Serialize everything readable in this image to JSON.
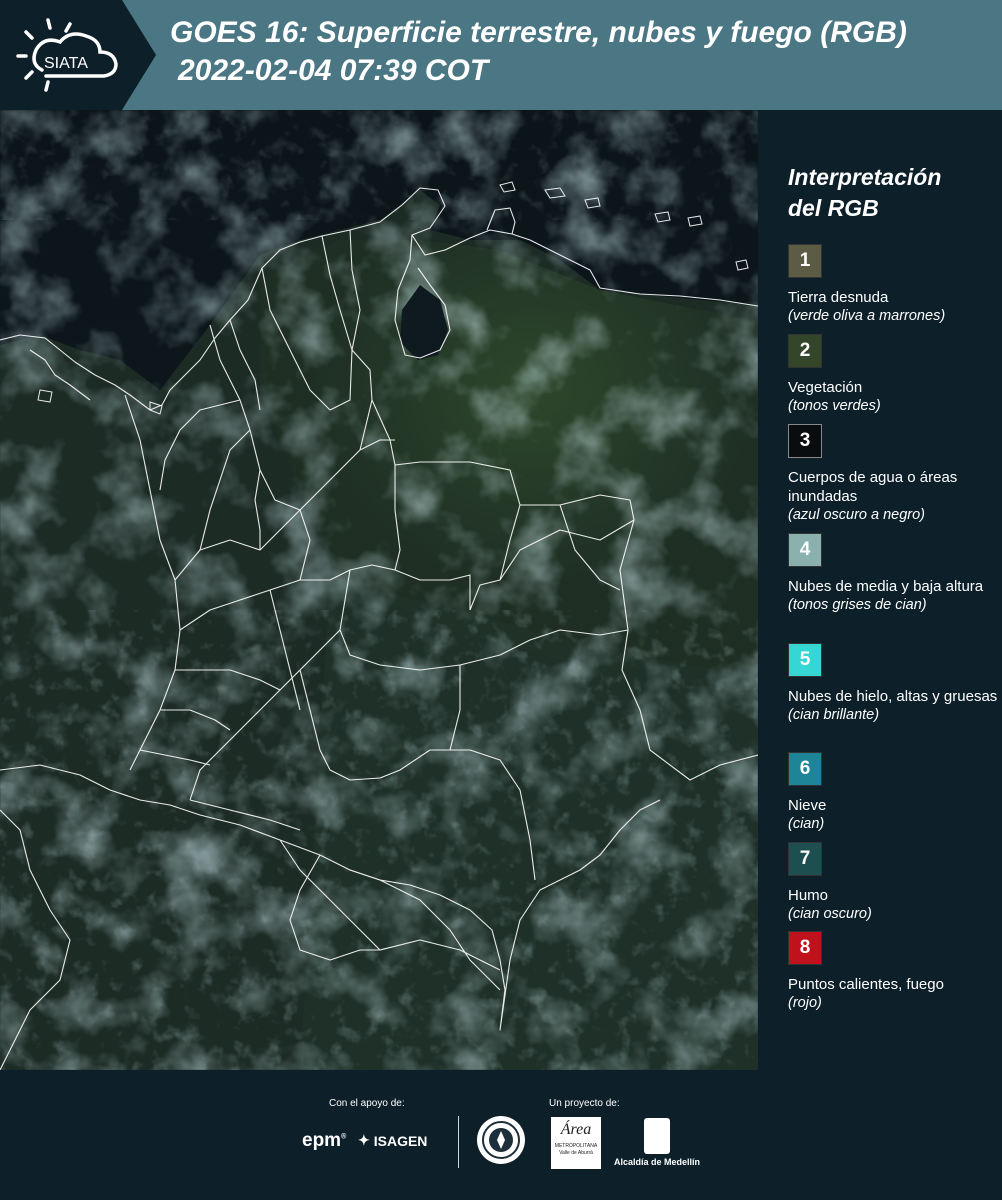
{
  "header": {
    "logo_text": "SIATA",
    "title_line1": "GOES 16: Superficie terrestre, nubes y fuego (RGB)",
    "title_line2": "2022-02-04 07:39 COT"
  },
  "legend": {
    "title_line1": "Interpretación",
    "title_line2": "del RGB",
    "items": [
      {
        "number": "1",
        "color": "#5c5c45",
        "label": "Tierra desnuda",
        "desc": "(verde oliva a marrones)"
      },
      {
        "number": "2",
        "color": "#34462a",
        "label": "Vegetación",
        "desc": "(tonos verdes)"
      },
      {
        "number": "3",
        "color": "#0a0d10",
        "label": "Cuerpos de agua o áreas inundadas",
        "desc": "(azul oscuro a negro)"
      },
      {
        "number": "4",
        "color": "#8ab1ad",
        "label": "Nubes de media y baja altura",
        "desc": "(tonos grises de cian)"
      },
      {
        "number": "5",
        "color": "#35d6d4",
        "label": "Nubes de hielo, altas y gruesas",
        "desc": "(cian brillante)"
      },
      {
        "number": "6",
        "color": "#1d8597",
        "label": "Nieve",
        "desc": "(cian)"
      },
      {
        "number": "7",
        "color": "#1d4f50",
        "label": "Humo",
        "desc": "(cian oscuro)"
      },
      {
        "number": "8",
        "color": "#c0121c",
        "label": "Puntos calientes, fuego",
        "desc": "(rojo)"
      }
    ]
  },
  "footer": {
    "support_label": "Con el apoyo de:",
    "project_label": "Un proyecto de:",
    "sponsor1": "epm",
    "sponsor2": "ISAGEN",
    "partner_area": "Área",
    "partner_area_sub": "METROPOLITANA Valle de Aburrá",
    "partner_alcaldia": "Alcaldía de Medellín"
  }
}
